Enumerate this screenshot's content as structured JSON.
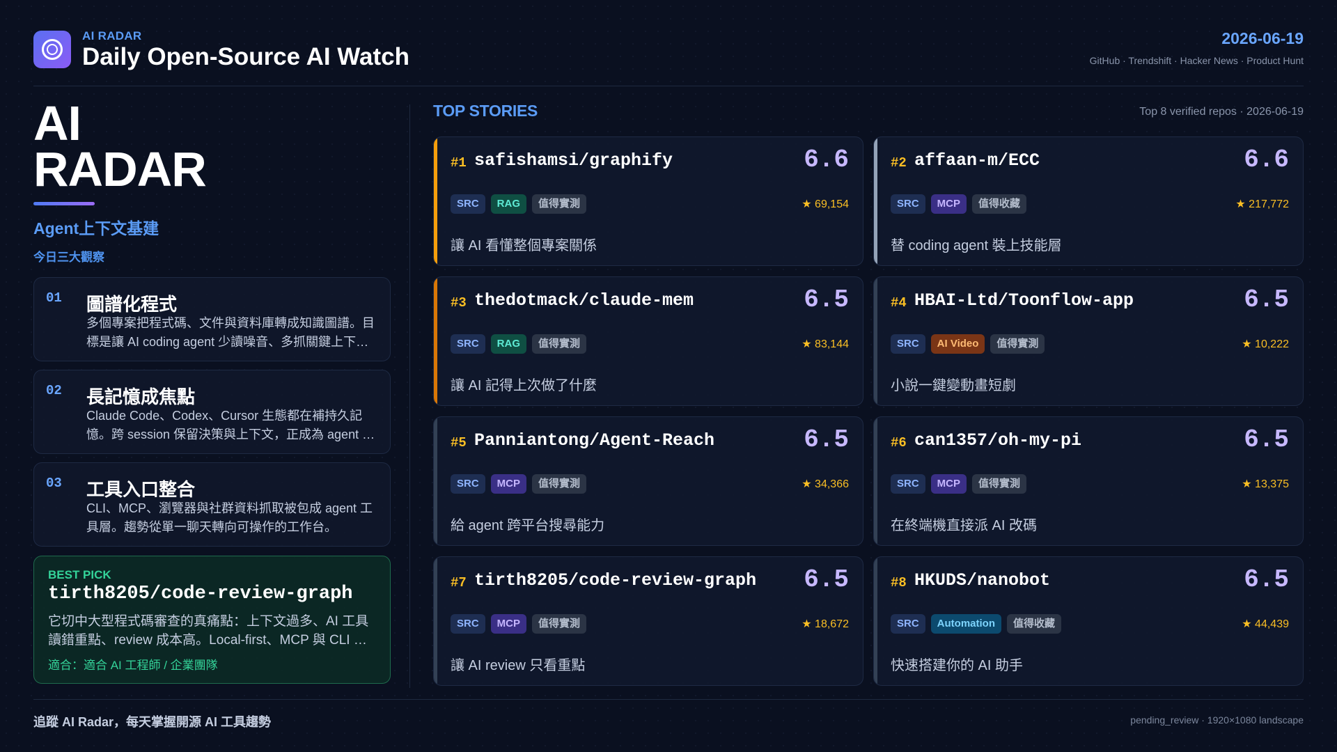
{
  "header": {
    "brand_small": "AI RADAR",
    "title": "Daily Open-Source AI Watch",
    "date": "2026-06-19",
    "sources": "GitHub · Trendshift · Hacker News · Product Hunt",
    "logo_icon": "radar-rings-icon"
  },
  "left": {
    "hero_line1": "AI",
    "hero_line2": "RADAR",
    "subtitle": "Agent上下文基建",
    "section_label": "今日三大觀察",
    "insights": [
      {
        "num": "01",
        "title": "圖譜化程式",
        "desc": "多個專案把程式碼、文件與資料庫轉成知識圖譜。目標是讓 AI coding agent 少讀噪音、多抓關鍵上下文。"
      },
      {
        "num": "02",
        "title": "長記憶成焦點",
        "desc": "Claude Code、Codex、Cursor 生態都在補持久記憶。跨 session 保留決策與上下文，正成為 agent 的標配。"
      },
      {
        "num": "03",
        "title": "工具入口整合",
        "desc": "CLI、MCP、瀏覽器與社群資料抓取被包成 agent 工具層。趨勢從單一聊天轉向可操作的工作台。"
      }
    ],
    "best_pick": {
      "label": "BEST PICK",
      "repo": "tirth8205/code-review-graph",
      "desc": "它切中大型程式碼審查的真痛點：上下文過多、AI 工具讀錯重點、review 成本高。Local-first、MCP 與 CLI 整合。",
      "fit": "適合：適合 AI 工程師 / 企業團隊"
    }
  },
  "top_stories": {
    "title": "TOP STORIES",
    "meta": "Top 8 verified repos · 2026-06-19",
    "star_icon": "star-icon",
    "cards": [
      {
        "rank": "#1",
        "repo": "safishamsi/graphify",
        "score": "6.6",
        "tags": [
          {
            "label": "SRC",
            "kind": "src"
          },
          {
            "label": "RAG",
            "kind": "rag"
          },
          {
            "label": "值得實測",
            "kind": "gray"
          }
        ],
        "stars": "★ 69,154",
        "desc": "讓 AI 看懂整個專案關係",
        "accent": "#f59e0b"
      },
      {
        "rank": "#2",
        "repo": "affaan-m/ECC",
        "score": "6.6",
        "tags": [
          {
            "label": "SRC",
            "kind": "src"
          },
          {
            "label": "MCP",
            "kind": "mcp"
          },
          {
            "label": "值得收藏",
            "kind": "gray"
          }
        ],
        "stars": "★ 217,772",
        "desc": "替 coding agent 裝上技能層",
        "accent": "#94a3b8"
      },
      {
        "rank": "#3",
        "repo": "thedotmack/claude-mem",
        "score": "6.5",
        "tags": [
          {
            "label": "SRC",
            "kind": "src"
          },
          {
            "label": "RAG",
            "kind": "rag"
          },
          {
            "label": "值得實測",
            "kind": "gray"
          }
        ],
        "stars": "★ 83,144",
        "desc": "讓 AI 記得上次做了什麼",
        "accent": "#d97706"
      },
      {
        "rank": "#4",
        "repo": "HBAI-Ltd/Toonflow-app",
        "score": "6.5",
        "tags": [
          {
            "label": "SRC",
            "kind": "src"
          },
          {
            "label": "AI Video",
            "kind": "ai-video"
          },
          {
            "label": "值得實測",
            "kind": "gray"
          }
        ],
        "stars": "★ 10,222",
        "desc": "小說一鍵變動畫短劇",
        "accent": "#334155"
      },
      {
        "rank": "#5",
        "repo": "Panniantong/Agent-Reach",
        "score": "6.5",
        "tags": [
          {
            "label": "SRC",
            "kind": "src"
          },
          {
            "label": "MCP",
            "kind": "mcp"
          },
          {
            "label": "值得實測",
            "kind": "gray"
          }
        ],
        "stars": "★ 34,366",
        "desc": "給 agent 跨平台搜尋能力",
        "accent": "#334155"
      },
      {
        "rank": "#6",
        "repo": "can1357/oh-my-pi",
        "score": "6.5",
        "tags": [
          {
            "label": "SRC",
            "kind": "src"
          },
          {
            "label": "MCP",
            "kind": "mcp"
          },
          {
            "label": "值得實測",
            "kind": "gray"
          }
        ],
        "stars": "★ 13,375",
        "desc": "在終端機直接派 AI 改碼",
        "accent": "#334155"
      },
      {
        "rank": "#7",
        "repo": "tirth8205/code-review-graph",
        "score": "6.5",
        "tags": [
          {
            "label": "SRC",
            "kind": "src"
          },
          {
            "label": "MCP",
            "kind": "mcp"
          },
          {
            "label": "值得實測",
            "kind": "gray"
          }
        ],
        "stars": "★ 18,672",
        "desc": "讓 AI review 只看重點",
        "accent": "#334155"
      },
      {
        "rank": "#8",
        "repo": "HKUDS/nanobot",
        "score": "6.5",
        "tags": [
          {
            "label": "SRC",
            "kind": "src"
          },
          {
            "label": "Automation",
            "kind": "automation"
          },
          {
            "label": "值得收藏",
            "kind": "gray"
          }
        ],
        "stars": "★ 44,439",
        "desc": "快速搭建你的 AI 助手",
        "accent": "#334155"
      }
    ]
  },
  "footer": {
    "left": "追蹤 AI Radar，每天掌握開源 AI 工具趨勢",
    "right": "pending_review · 1920×1080 landscape"
  }
}
